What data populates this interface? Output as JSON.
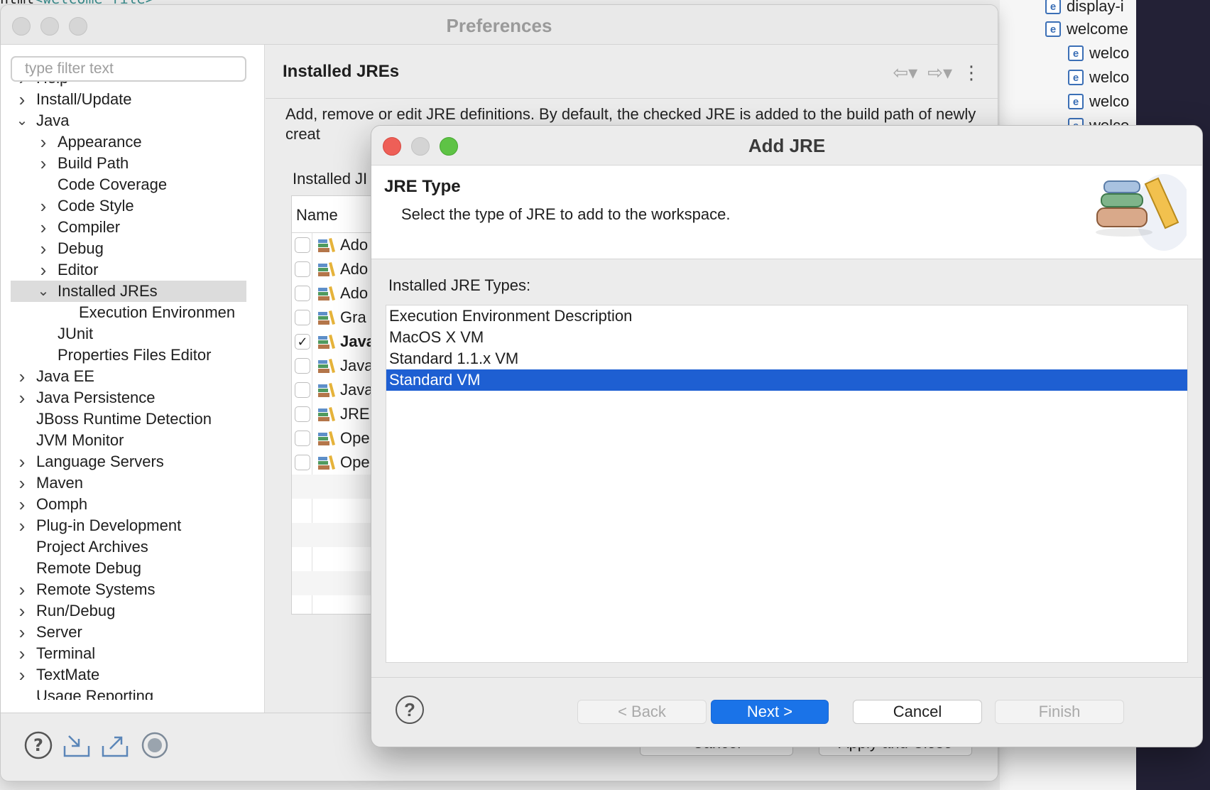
{
  "background": {
    "code_line": {
      "prefix": "html",
      "tag": "<welcome-file>"
    },
    "project_items": [
      {
        "label": "display-i",
        "indent": false,
        "twisty": false
      },
      {
        "label": "welcome",
        "indent": false,
        "twisty": true
      },
      {
        "label": "welco",
        "indent": true,
        "twisty": false
      },
      {
        "label": "welco",
        "indent": true,
        "twisty": false
      },
      {
        "label": "welco",
        "indent": true,
        "twisty": false
      },
      {
        "label": "welco",
        "indent": true,
        "twisty": false
      }
    ]
  },
  "preferences": {
    "title": "Preferences",
    "filter_placeholder": "type filter text",
    "tree": [
      {
        "label": "Help",
        "level": 0,
        "chevron": "right"
      },
      {
        "label": "Install/Update",
        "level": 0,
        "chevron": "right"
      },
      {
        "label": "Java",
        "level": 0,
        "chevron": "down"
      },
      {
        "label": "Appearance",
        "level": 1,
        "chevron": "right"
      },
      {
        "label": "Build Path",
        "level": 1,
        "chevron": "right"
      },
      {
        "label": "Code Coverage",
        "level": 1,
        "chevron": "none"
      },
      {
        "label": "Code Style",
        "level": 1,
        "chevron": "right"
      },
      {
        "label": "Compiler",
        "level": 1,
        "chevron": "right"
      },
      {
        "label": "Debug",
        "level": 1,
        "chevron": "right"
      },
      {
        "label": "Editor",
        "level": 1,
        "chevron": "right"
      },
      {
        "label": "Installed JREs",
        "level": 1,
        "chevron": "down",
        "selected": true
      },
      {
        "label": "Execution Environmen",
        "level": 2,
        "chevron": "none"
      },
      {
        "label": "JUnit",
        "level": 1,
        "chevron": "none"
      },
      {
        "label": "Properties Files Editor",
        "level": 1,
        "chevron": "none"
      },
      {
        "label": "Java EE",
        "level": 0,
        "chevron": "right"
      },
      {
        "label": "Java Persistence",
        "level": 0,
        "chevron": "right"
      },
      {
        "label": "JBoss Runtime Detection",
        "level": 0,
        "chevron": "none"
      },
      {
        "label": "JVM Monitor",
        "level": 0,
        "chevron": "none"
      },
      {
        "label": "Language Servers",
        "level": 0,
        "chevron": "right"
      },
      {
        "label": "Maven",
        "level": 0,
        "chevron": "right"
      },
      {
        "label": "Oomph",
        "level": 0,
        "chevron": "right"
      },
      {
        "label": "Plug-in Development",
        "level": 0,
        "chevron": "right"
      },
      {
        "label": "Project Archives",
        "level": 0,
        "chevron": "none"
      },
      {
        "label": "Remote Debug",
        "level": 0,
        "chevron": "none"
      },
      {
        "label": "Remote Systems",
        "level": 0,
        "chevron": "right"
      },
      {
        "label": "Run/Debug",
        "level": 0,
        "chevron": "right"
      },
      {
        "label": "Server",
        "level": 0,
        "chevron": "right"
      },
      {
        "label": "Terminal",
        "level": 0,
        "chevron": "right"
      },
      {
        "label": "TextMate",
        "level": 0,
        "chevron": "right"
      },
      {
        "label": "Usage Reporting",
        "level": 0,
        "chevron": "none"
      }
    ],
    "page": {
      "title": "Installed JREs",
      "description": "Add, remove or edit JRE definitions. By default, the checked JRE is added to the build path of newly creat",
      "installed_label": "Installed JI",
      "table_header_name": "Name",
      "rows": [
        {
          "label": "Ado",
          "checked": false,
          "bold": false
        },
        {
          "label": "Ado",
          "checked": false,
          "bold": false
        },
        {
          "label": "Ado",
          "checked": false,
          "bold": false
        },
        {
          "label": "Gra",
          "checked": false,
          "bold": false
        },
        {
          "label": "Java",
          "checked": true,
          "bold": true
        },
        {
          "label": "Java",
          "checked": false,
          "bold": false
        },
        {
          "label": "Java",
          "checked": false,
          "bold": false
        },
        {
          "label": "JRE",
          "checked": false,
          "bold": false
        },
        {
          "label": "Ope",
          "checked": false,
          "bold": false
        },
        {
          "label": "Ope",
          "checked": false,
          "bold": false
        }
      ]
    },
    "footer": {
      "cancel_label": "Cancel",
      "apply_close_label": "Apply and Close"
    }
  },
  "add_jre": {
    "title": "Add JRE",
    "heading": "JRE Type",
    "subtitle": "Select the type of JRE to add to the workspace.",
    "types_label": "Installed JRE Types:",
    "types": [
      {
        "label": "Execution Environment Description",
        "selected": false
      },
      {
        "label": "MacOS X VM",
        "selected": false
      },
      {
        "label": "Standard 1.1.x VM",
        "selected": false
      },
      {
        "label": "Standard VM",
        "selected": true
      }
    ],
    "buttons": {
      "back": "< Back",
      "next": "Next >",
      "cancel": "Cancel",
      "finish": "Finish"
    },
    "accent_color": "#1e5fd2"
  }
}
